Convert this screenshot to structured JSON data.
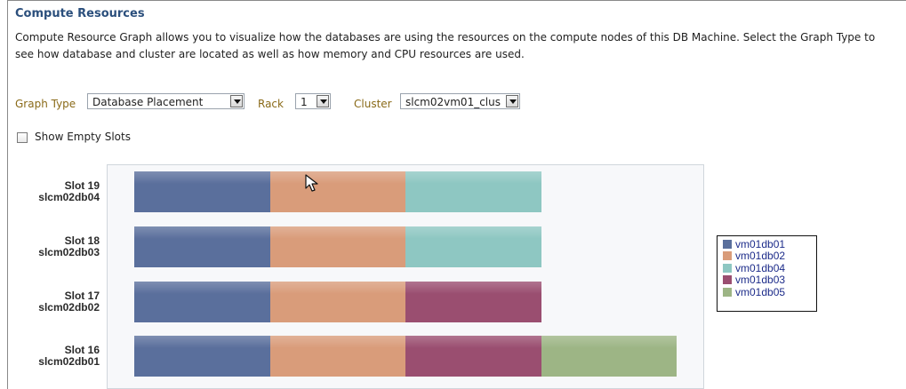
{
  "section": {
    "title": "Compute Resources",
    "description_line1": "Compute Resource Graph allows you to visualize how the databases are using the resources on the compute nodes of this DB Machine. Select the Graph Type to",
    "description_line2": "see how database and cluster are located as well as how memory and CPU resources are used."
  },
  "controls": {
    "graph_type_label": "Graph Type",
    "graph_type_value": "Database Placement",
    "rack_label": "Rack",
    "rack_value": "1",
    "cluster_label": "Cluster",
    "cluster_value": "slcm02vm01_clus",
    "show_empty_slots_label": "Show Empty Slots",
    "show_empty_slots_checked": false
  },
  "chart": {
    "colors": {
      "vm01db01": "#5a6f9c",
      "vm01db02": "#d99c7a",
      "vm01db04": "#8ec7c2",
      "vm01db03": "#9a4e70",
      "vm01db05": "#9db585"
    },
    "rows": [
      {
        "slot": "Slot 19",
        "host": "slcm02db04",
        "segments": [
          "vm01db01",
          "vm01db02",
          "vm01db04"
        ]
      },
      {
        "slot": "Slot 18",
        "host": "slcm02db03",
        "segments": [
          "vm01db01",
          "vm01db02",
          "vm01db04"
        ]
      },
      {
        "slot": "Slot 17",
        "host": "slcm02db02",
        "segments": [
          "vm01db01",
          "vm01db02",
          "vm01db03"
        ]
      },
      {
        "slot": "Slot 16",
        "host": "slcm02db01",
        "segments": [
          "vm01db01",
          "vm01db02",
          "vm01db03",
          "vm01db05"
        ]
      }
    ],
    "legend": [
      "vm01db01",
      "vm01db02",
      "vm01db04",
      "vm01db03",
      "vm01db05"
    ]
  }
}
